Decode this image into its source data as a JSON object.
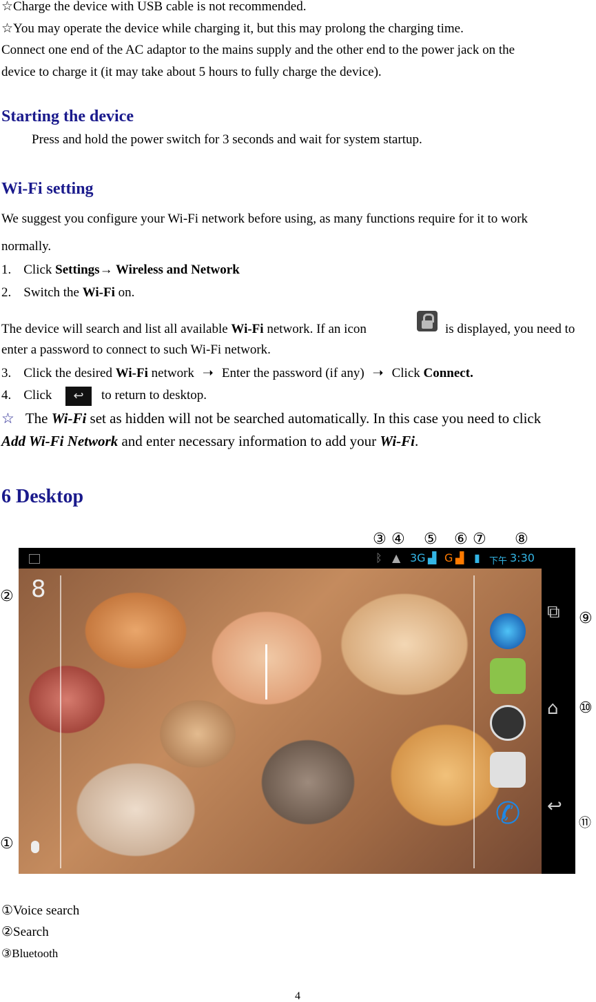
{
  "intro": {
    "line1": "☆Charge the device with USB cable is not recommended.",
    "line2": "☆You may operate the device while charging it, but this may prolong the charging time.",
    "line3": "Connect one end of the AC adaptor to the mains supply and the other end to the power jack on the",
    "line4": "device to charge it (it may take about 5 hours to fully charge the device)."
  },
  "starting": {
    "heading": "Starting the device",
    "text": "Press and hold the power switch for 3 seconds and wait for system startup."
  },
  "wifi": {
    "heading": "Wi-Fi setting",
    "p1": "We suggest you configure your Wi-Fi network before using, as many functions require for it to work",
    "p2": "normally.",
    "s1_num": "1.",
    "s1_a": "Click ",
    "s1_b": "Settings→ Wireless and Network",
    "s2_num": "2.",
    "s2_a": "Switch the ",
    "s2_b": "Wi-Fi",
    "s2_c": " on.",
    "p3_a": "The device will search and list all available ",
    "p3_b": "Wi-Fi",
    "p3_c": " network. If an icon",
    "p3_d": "is displayed, you need to",
    "p4": "enter a password to connect to such Wi-Fi network.",
    "s3_num": "3.",
    "s3_a": "Click the desired ",
    "s3_b": "Wi-Fi",
    "s3_c": " network",
    "s3_d": "Enter the password (if any)",
    "s3_e": "Click ",
    "s3_f": "Connect.",
    "s4_num": "4.",
    "s4_a": "Click",
    "s4_b": "to return to desktop.",
    "note_a": "☆",
    "note_b": "The ",
    "note_c": "Wi-Fi",
    "note_d": " set as hidden will not be searched automatically. In this case you need to click",
    "note_e": "Add Wi-Fi Network",
    "note_f": " and enter necessary information to add your ",
    "note_g": "Wi-Fi",
    "note_h": "."
  },
  "desktop": {
    "heading": "6 Desktop",
    "callouts": {
      "c1": "①",
      "c2": "②",
      "c3": "③",
      "c4": "④",
      "c5": "⑤",
      "c6": "⑥",
      "c7": "⑦",
      "c8": "⑧",
      "c9": "⑨",
      "c10": "⑩",
      "c11": "⑪"
    },
    "status": {
      "net1": "3G",
      "net2": "G",
      "ampm": "下午",
      "time": "3:30"
    },
    "search_glyph": "8",
    "accent": "#33b5e5"
  },
  "legend": [
    {
      "num": "①",
      "label": "Voice search"
    },
    {
      "num": "②",
      "label": "Search"
    },
    {
      "num": "③",
      "label": "Bluetooth"
    }
  ],
  "page_number": "4"
}
